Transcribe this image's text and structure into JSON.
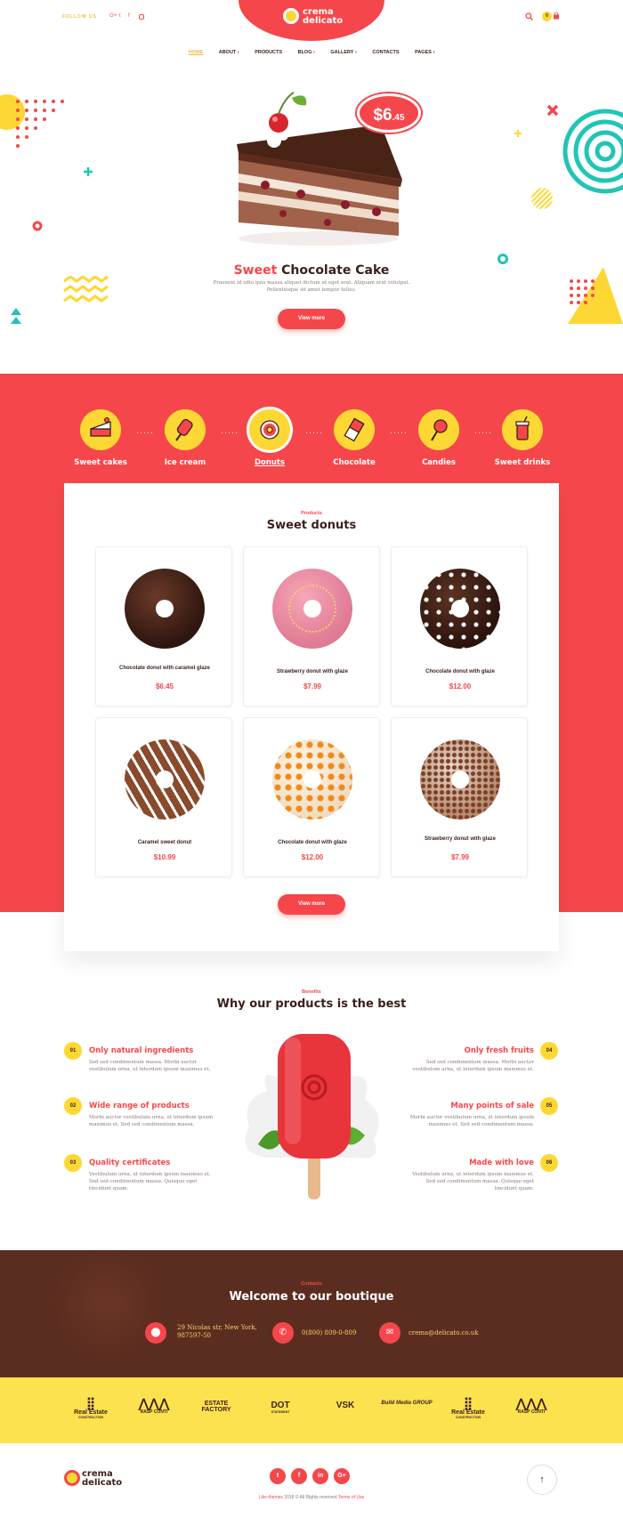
{
  "header": {
    "follow_label": "FOLLOW US",
    "social_icons": [
      "google-plus-icon",
      "twitter-icon",
      "facebook-icon",
      "instagram-icon"
    ],
    "logo_line1": "crema",
    "logo_line2": "delicato",
    "cart_count": "0"
  },
  "nav": {
    "items": [
      "HOME",
      "ABOUT",
      "PRODUCTS",
      "BLOG",
      "GALLERY",
      "CONTACTS",
      "PAGES"
    ]
  },
  "hero": {
    "price_main": "$6",
    "price_cents": ".45",
    "title_accent": "Sweet",
    "title_rest": "Chocolate Cake",
    "description": "Praesent id odio quis massa aliquet dictum ut eget erat. Aliquam erat volutpat. Pellentesque sit amet tempor tellus.",
    "button": "View more"
  },
  "categories": {
    "items": [
      "Sweet cakes",
      "Ice cream",
      "Donuts",
      "Chocolate",
      "Candies",
      "Sweet drinks"
    ],
    "active": "Donuts"
  },
  "products": {
    "subtitle": "Products",
    "title": "Sweet donuts",
    "button": "View more",
    "items": [
      {
        "name": "Chocolate donut with caramel glaze",
        "price": "$6.45"
      },
      {
        "name": "Strawberry donut with glaze",
        "price": "$7.99"
      },
      {
        "name": "Chocolate donut with glaze",
        "price": "$12.00"
      },
      {
        "name": "Caramel sweet donut",
        "price": "$10.99"
      },
      {
        "name": "Chocolate donut with glaze",
        "price": "$12.00"
      },
      {
        "name": "Strawberry donut with glaze",
        "price": "$7.99"
      }
    ]
  },
  "benefits": {
    "subtitle": "Benefits",
    "title": "Why our products is the best",
    "items": [
      {
        "num": "01",
        "title": "Only natural ingredients",
        "text": "Sed sed condimentum massa. Morbi auctor vestibulum urna, ut interdum ipsum maximus et."
      },
      {
        "num": "02",
        "title": "Wide range of products",
        "text": "Morbi auctor vestibulum urna, ut interdum ipsum maximus et. Sed sed condimentum massa."
      },
      {
        "num": "03",
        "title": "Quality certificates",
        "text": "Vestibulum urna, ut interdum ipsum maximus et. Sed sed condimentum massa. Quisque eget tincidunt quam."
      },
      {
        "num": "04",
        "title": "Only fresh fruits",
        "text": "Sed sed condimentum massa. Morbi auctor vestibulum urna, ut interdum ipsum maximus et."
      },
      {
        "num": "05",
        "title": "Many points of sale",
        "text": "Morbi auctor vestibulum urna, ut interdum ipsum maximus et. Sed sed condimentum massa."
      },
      {
        "num": "06",
        "title": "Made with love",
        "text": "Vestibulum urna, ut interdum ipsum maximus et. Sed sed condimentum massa. Quisque eget tincidunt quam."
      }
    ]
  },
  "contacts": {
    "subtitle": "Contacts",
    "title": "Welcome to our boutique",
    "address": "29 Nicolas str, New York, 987597-50",
    "phone": "0(800) 809-0-809",
    "email": "crema@delicato.co.uk"
  },
  "partners": [
    {
      "name": "Real Estate",
      "sub": "CONSTRUCTION"
    },
    {
      "name": "RASP CONTI",
      "sub": ""
    },
    {
      "name": "ESTATE FACTORY",
      "sub": ""
    },
    {
      "name": "DOT",
      "sub": "STATEMENT"
    },
    {
      "name": "VSK",
      "sub": ""
    },
    {
      "name": "Build Media GROUP",
      "sub": ""
    },
    {
      "name": "Real Estate",
      "sub": "CONSTRUCTION"
    },
    {
      "name": "RASP CONTI",
      "sub": ""
    }
  ],
  "footer": {
    "logo_line1": "crema",
    "logo_line2": "delicato",
    "social": [
      "t",
      "f",
      "in",
      "G+"
    ],
    "copy_brand": "Like-themes",
    "copy_mid": " 2018 © All Rights reserved ",
    "copy_link": "Terms of Use"
  },
  "colors": {
    "primary": "#f5474b",
    "yellow": "#fdd835",
    "brown": "#3b1f1a"
  }
}
